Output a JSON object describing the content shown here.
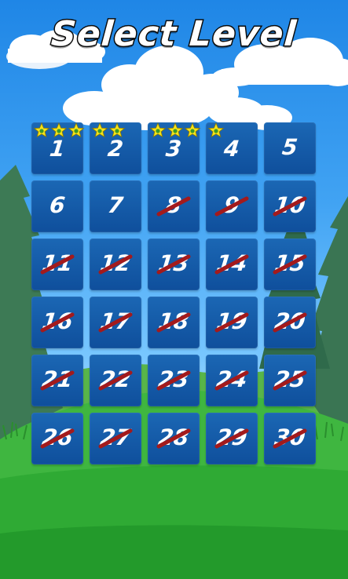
{
  "title": "Select Level",
  "colors": {
    "tile": "#1059a8",
    "tile_text": "#ffffff",
    "star": "#f5e41a",
    "lock_slash": "#a31a1c"
  },
  "levels": [
    {
      "label": "1",
      "stars": 3,
      "locked": false
    },
    {
      "label": "2",
      "stars": 2,
      "locked": false
    },
    {
      "label": "3",
      "stars": 3,
      "locked": false
    },
    {
      "label": "4",
      "stars": 1,
      "locked": false
    },
    {
      "label": "5",
      "stars": 0,
      "locked": false
    },
    {
      "label": "6",
      "stars": 0,
      "locked": false
    },
    {
      "label": "7",
      "stars": 0,
      "locked": false
    },
    {
      "label": "8",
      "stars": 0,
      "locked": true
    },
    {
      "label": "9",
      "stars": 0,
      "locked": true
    },
    {
      "label": "10",
      "stars": 0,
      "locked": true
    },
    {
      "label": "11",
      "stars": 0,
      "locked": true
    },
    {
      "label": "12",
      "stars": 0,
      "locked": true
    },
    {
      "label": "13",
      "stars": 0,
      "locked": true
    },
    {
      "label": "14",
      "stars": 0,
      "locked": true
    },
    {
      "label": "15",
      "stars": 0,
      "locked": true
    },
    {
      "label": "16",
      "stars": 0,
      "locked": true
    },
    {
      "label": "17",
      "stars": 0,
      "locked": true
    },
    {
      "label": "18",
      "stars": 0,
      "locked": true
    },
    {
      "label": "19",
      "stars": 0,
      "locked": true
    },
    {
      "label": "20",
      "stars": 0,
      "locked": true
    },
    {
      "label": "21",
      "stars": 0,
      "locked": true
    },
    {
      "label": "22",
      "stars": 0,
      "locked": true
    },
    {
      "label": "23",
      "stars": 0,
      "locked": true
    },
    {
      "label": "24",
      "stars": 0,
      "locked": true
    },
    {
      "label": "25",
      "stars": 0,
      "locked": true
    },
    {
      "label": "26",
      "stars": 0,
      "locked": true
    },
    {
      "label": "27",
      "stars": 0,
      "locked": true
    },
    {
      "label": "28",
      "stars": 0,
      "locked": true
    },
    {
      "label": "29",
      "stars": 0,
      "locked": true
    },
    {
      "label": "30",
      "stars": 0,
      "locked": true
    }
  ]
}
